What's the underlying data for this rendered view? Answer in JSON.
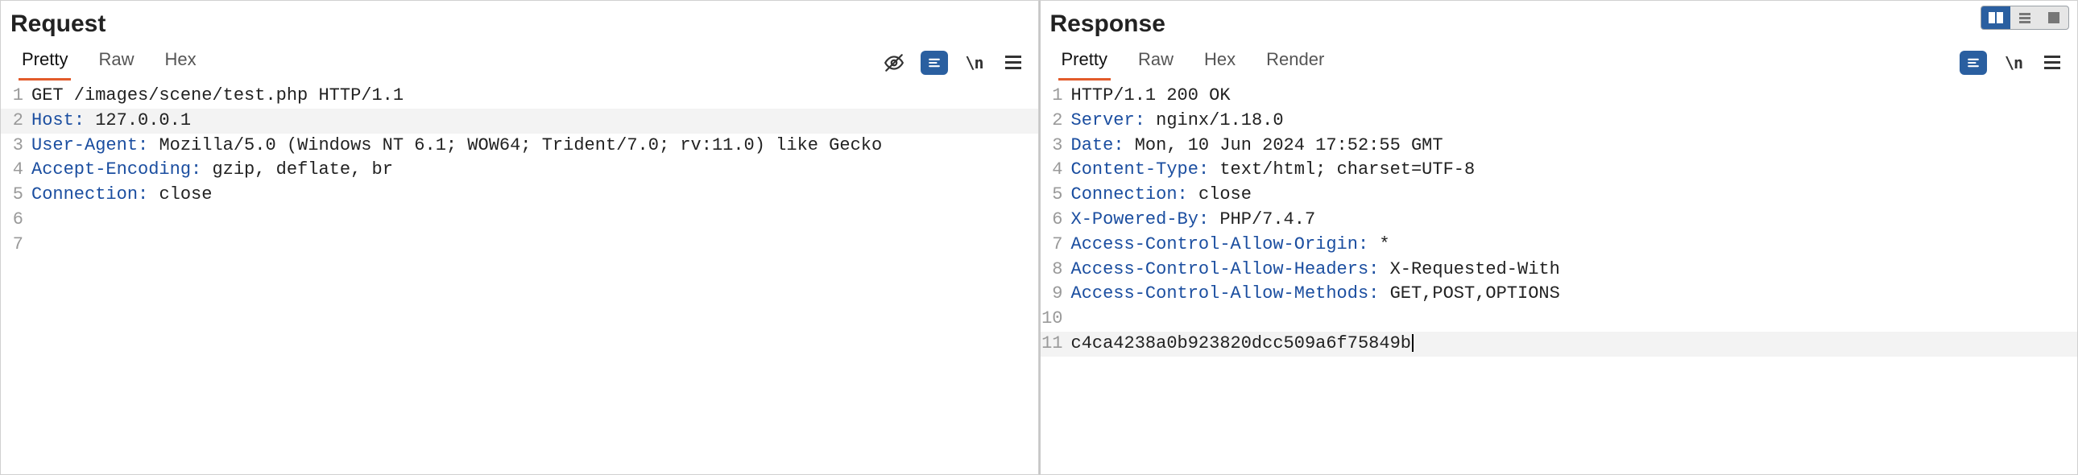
{
  "request": {
    "title": "Request",
    "tabs": {
      "pretty": "Pretty",
      "raw": "Raw",
      "hex": "Hex"
    },
    "newline_indicator": "\\n",
    "lines": [
      {
        "n": "1",
        "type": "plain",
        "text": "GET /images/scene/test.php HTTP/1.1"
      },
      {
        "n": "2",
        "type": "header",
        "name": "Host",
        "value": "127.0.0.1",
        "hl": true
      },
      {
        "n": "3",
        "type": "header",
        "name": "User-Agent",
        "value": "Mozilla/5.0 (Windows NT 6.1; WOW64; Trident/7.0; rv:11.0) like Gecko"
      },
      {
        "n": "4",
        "type": "header",
        "name": "Accept-Encoding",
        "value": "gzip, deflate, br"
      },
      {
        "n": "5",
        "type": "header",
        "name": "Connection",
        "value": "close"
      },
      {
        "n": "6",
        "type": "plain",
        "text": ""
      },
      {
        "n": "7",
        "type": "plain",
        "text": ""
      }
    ]
  },
  "response": {
    "title": "Response",
    "tabs": {
      "pretty": "Pretty",
      "raw": "Raw",
      "hex": "Hex",
      "render": "Render"
    },
    "newline_indicator": "\\n",
    "lines": [
      {
        "n": "1",
        "type": "plain",
        "text": "HTTP/1.1 200 OK"
      },
      {
        "n": "2",
        "type": "header",
        "name": "Server",
        "value": "nginx/1.18.0"
      },
      {
        "n": "3",
        "type": "header",
        "name": "Date",
        "value": "Mon, 10 Jun 2024 17:52:55 GMT"
      },
      {
        "n": "4",
        "type": "header",
        "name": "Content-Type",
        "value": "text/html; charset=UTF-8"
      },
      {
        "n": "5",
        "type": "header",
        "name": "Connection",
        "value": "close"
      },
      {
        "n": "6",
        "type": "header",
        "name": "X-Powered-By",
        "value": "PHP/7.4.7"
      },
      {
        "n": "7",
        "type": "header",
        "name": "Access-Control-Allow-Origin",
        "value": "*"
      },
      {
        "n": "8",
        "type": "header",
        "name": "Access-Control-Allow-Headers",
        "value": "X-Requested-With"
      },
      {
        "n": "9",
        "type": "header",
        "name": "Access-Control-Allow-Methods",
        "value": "GET,POST,OPTIONS"
      },
      {
        "n": "10",
        "type": "plain",
        "text": ""
      },
      {
        "n": "11",
        "type": "plain",
        "text": "c4ca4238a0b923820dcc509a6f75849b",
        "hl": true,
        "caret": true
      }
    ]
  }
}
